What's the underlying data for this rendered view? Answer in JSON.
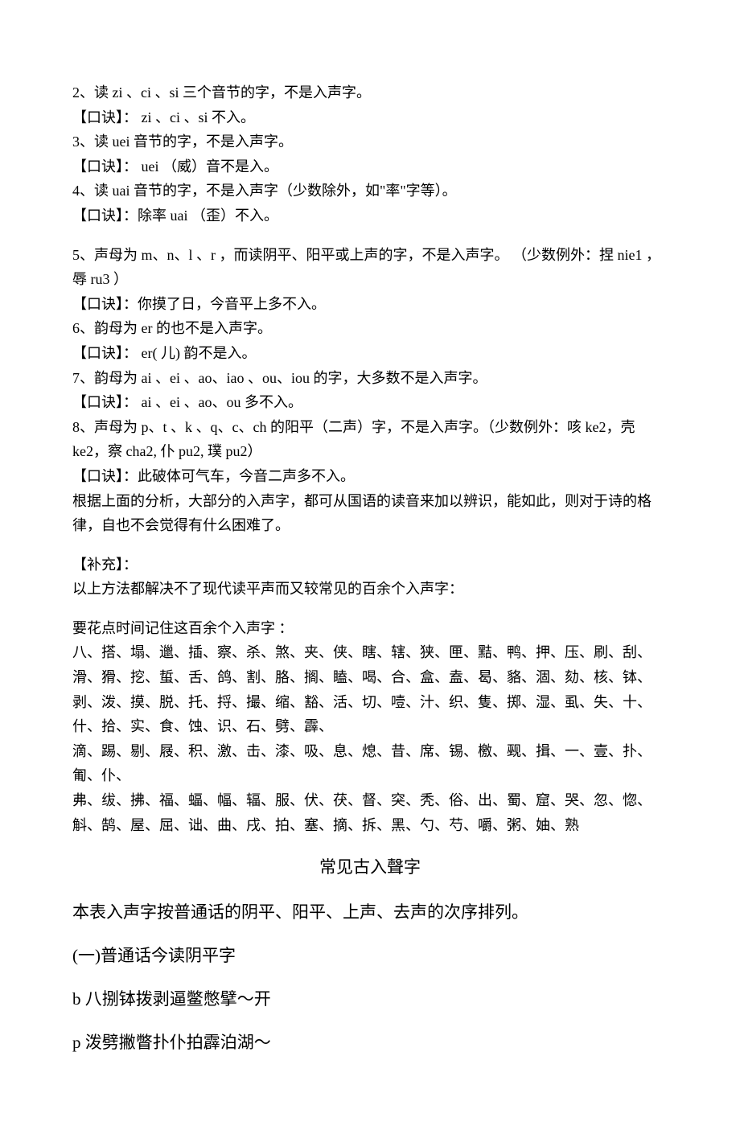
{
  "rules": {
    "r2": "2、读 zi 、ci 、si 三个音节的字，不是入声字。",
    "r2k": "【口诀】： zi 、ci 、si 不入。",
    "r3": "3、读 uei 音节的字，不是入声字。",
    "r3k": "【口诀】： uei （威）音不是入。",
    "r4": "4、读 uai 音节的字，不是入声字（少数除外，如\"率\"字等）。",
    "r4k": "【口诀】：除率  uai （歪）不入。",
    "r5": "5、声母为 m、n、l 、r ，而读阴平、阳平或上声的字，不是入声字。  （少数例外：捏 nie1 ，辱 ru3 ）",
    "r5k": "【口诀】：你摸了日，今音平上多不入。",
    "r6": "6、韵母为 er 的也不是入声字。",
    "r6k": "【口诀】： er( 儿) 韵不是入。",
    "r7": "7、韵母为 ai 、ei 、ao、iao 、ou、iou 的字，大多数不是入声字。",
    "r7k": "【口诀】： ai 、ei 、ao、ou 多不入。",
    "r8": "8、声母为 p、t 、k 、q、c、ch 的阳平（二声）字，不是入声字。（少数例外：咳 ke2，壳 ke2，察 cha2, 仆 pu2,  璞 pu2）",
    "r8k": "【口诀】：此破体可气车，今音二声多不入。",
    "summary": "根据上面的分析，大部分的入声字，都可从国语的读音来加以辨识，能如此，则对于诗的格律，自也不会觉得有什么困难了。"
  },
  "supplement": {
    "head": "【补充】：",
    "intro": "以上方法都解决不了现代读平声而又较常见的百余个入声字：",
    "lead": "要花点时间记住这百余个入声字  ：",
    "l1": "八、搭、塌、邋、插、察、杀、煞、夹、侠、瞎、辖、狭、匣、黠、鸭、押、压、刷、刮、滑、猾、挖、蜇、舌、鸽、割、胳、搁、瞌、喝、合、盒、盍、曷、貉、涸、劾、核、钵、剥、泼、摸、脱、托、捋、撮、缩、豁、活、切、噎、汁、织、隻、掷、湿、虱、失、十、什、拾、实、食、蚀、识、石、劈、霹、",
    "l2": "滴、踢、剔、屐、积、激、击、漆、吸、息、熄、昔、席、锡、檄、觋、揖、一、壹、扑、匍、仆、",
    "l3": "弗、绂、拂、福、蝠、幅、辐、服、伏、茯、督、突、秃、俗、出、蜀、窟、哭、忽、惚、斛、鹄、屋、屈、诎、曲、戌、拍、塞、摘、拆、黑、勺、芍、嚼、粥、妯、熟"
  },
  "section": {
    "title": "常见古入聲字",
    "intro": "本表入声字按普通话的阴平、阳平、上声、去声的次序排列。",
    "sub1": "(一)普通话今读阴平字",
    "b": "b  八捌钵拨剥逼鳖憋擘～开",
    "p": "p  泼劈撇瞥扑仆拍霹泊湖～"
  }
}
